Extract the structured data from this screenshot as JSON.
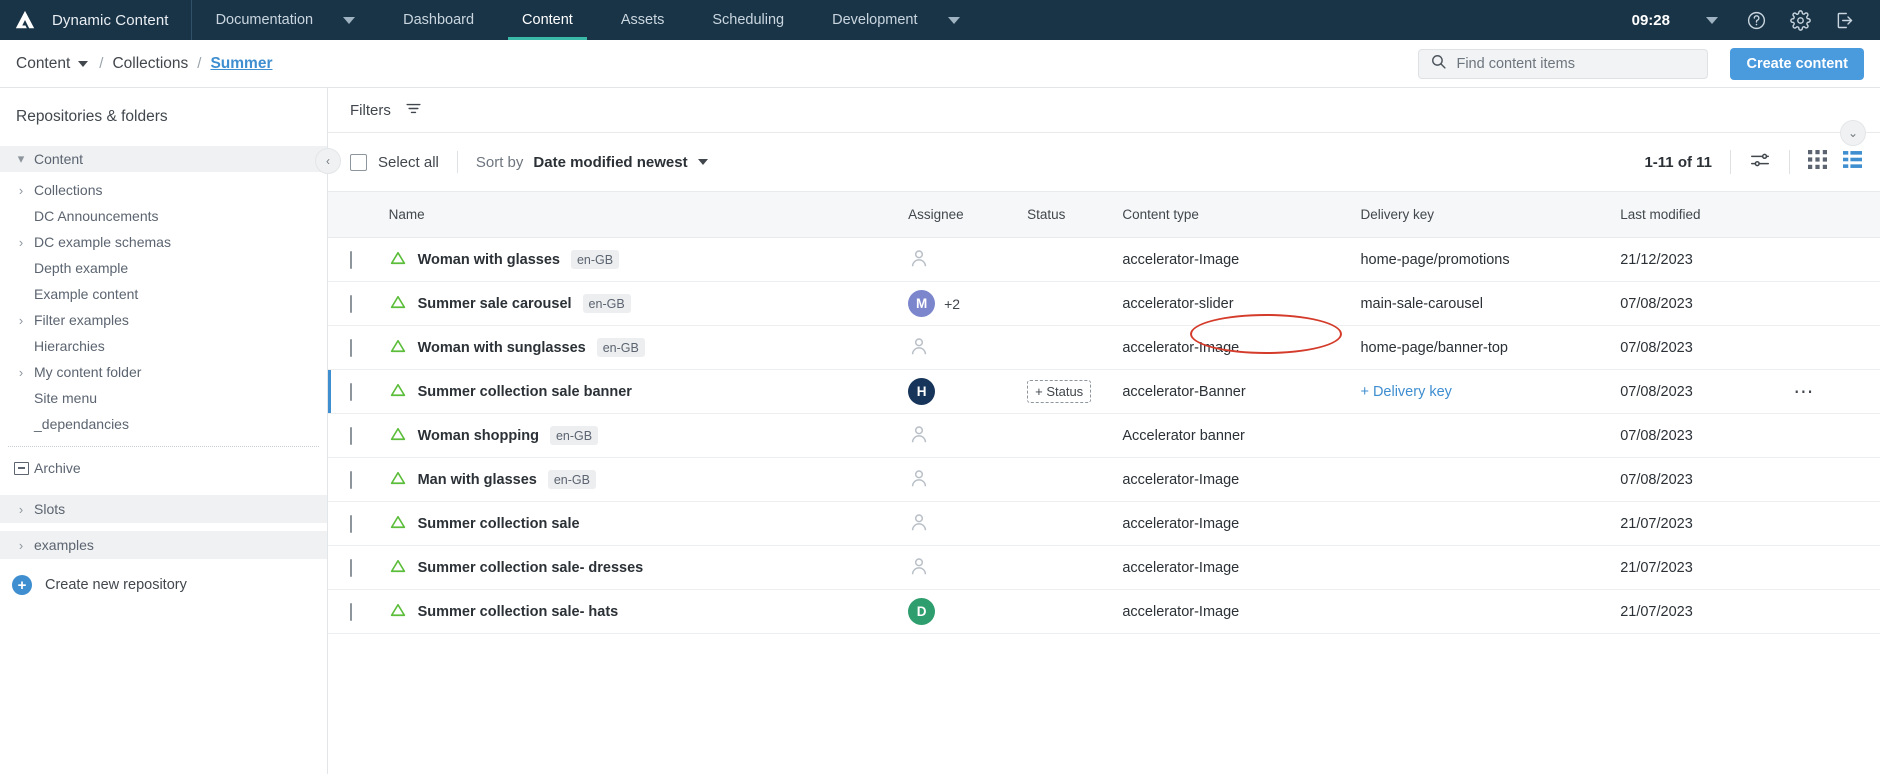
{
  "topnav": {
    "logo_icon": "amplience-logo-icon",
    "brand": "Dynamic Content",
    "items": [
      {
        "label": "Documentation",
        "active": false,
        "caret": true
      },
      {
        "label": "Dashboard",
        "active": false,
        "caret": false
      },
      {
        "label": "Content",
        "active": true,
        "caret": false
      },
      {
        "label": "Assets",
        "active": false,
        "caret": false
      },
      {
        "label": "Scheduling",
        "active": false,
        "caret": false
      },
      {
        "label": "Development",
        "active": false,
        "caret": true
      }
    ],
    "clock": "09:28",
    "user_caret_icon": "chevron-down-icon",
    "help_icon": "help-circle-icon",
    "settings_icon": "gear-icon",
    "logout_icon": "logout-icon"
  },
  "breadcrumb": {
    "items": [
      {
        "label": "Content",
        "caret": true,
        "link": false
      },
      {
        "label": "Collections",
        "caret": false,
        "link": false
      },
      {
        "label": "Summer",
        "caret": false,
        "link": true
      }
    ],
    "separator": "/"
  },
  "search": {
    "icon": "search-icon",
    "placeholder": "Find content items",
    "value": ""
  },
  "actions": {
    "create_content": "Create content"
  },
  "sidebar": {
    "title": "Repositories & folders",
    "tree": [
      {
        "label": "Content",
        "indent": 0,
        "chevron": "down",
        "shaded": true,
        "icon": null
      },
      {
        "label": "Collections",
        "indent": 1,
        "chevron": "right",
        "shaded": false,
        "icon": null
      },
      {
        "label": "DC Announcements",
        "indent": 1,
        "chevron": "none",
        "shaded": false,
        "icon": null
      },
      {
        "label": "DC example schemas",
        "indent": 1,
        "chevron": "right",
        "shaded": false,
        "icon": null
      },
      {
        "label": "Depth example",
        "indent": 1,
        "chevron": "none",
        "shaded": false,
        "icon": null
      },
      {
        "label": "Example content",
        "indent": 1,
        "chevron": "none",
        "shaded": false,
        "icon": null
      },
      {
        "label": "Filter examples",
        "indent": 1,
        "chevron": "right",
        "shaded": false,
        "icon": null
      },
      {
        "label": "Hierarchies",
        "indent": 1,
        "chevron": "none",
        "shaded": false,
        "icon": null
      },
      {
        "label": "My content folder",
        "indent": 1,
        "chevron": "right",
        "shaded": false,
        "icon": null
      },
      {
        "label": "Site menu",
        "indent": 1,
        "chevron": "none",
        "shaded": false,
        "icon": null
      },
      {
        "label": "_dependancies",
        "indent": 1,
        "chevron": "none",
        "shaded": false,
        "icon": null
      }
    ],
    "archive": {
      "label": "Archive",
      "icon": "archive-box-icon"
    },
    "groups": [
      {
        "label": "Slots",
        "chevron": "right",
        "shaded": true
      },
      {
        "label": "examples",
        "chevron": "right",
        "shaded": true
      }
    ],
    "create_repository": {
      "label": "Create new repository",
      "icon": "plus-circle-icon"
    }
  },
  "filters": {
    "label": "Filters",
    "icon": "filter-icon"
  },
  "toolbar": {
    "select_all": "Select all",
    "sort_by_label": "Sort by",
    "sort_by_value": "Date modified newest",
    "sort_caret_icon": "chevron-down-icon",
    "result_count": "1-11 of 11",
    "settings_icon": "sliders-icon",
    "grid_view_icon": "grid-view-icon",
    "list_view_icon": "list-view-icon",
    "collapse_icon": "chevron-left-icon",
    "scroll_icon": "chevron-down-icon"
  },
  "table": {
    "columns": [
      "Name",
      "Assignee",
      "Status",
      "Content type",
      "Delivery key",
      "Last modified"
    ],
    "rows": [
      {
        "name": "Woman with glasses",
        "locale": "en-GB",
        "assignee": null,
        "status": null,
        "content_type": "accelerator-Image",
        "delivery_key": "home-page/promotions",
        "last_modified": "21/12/2023",
        "selected": false,
        "menu": false
      },
      {
        "name": "Summer sale carousel",
        "locale": "en-GB",
        "assignee": {
          "initial": "M",
          "color": "#7b86cc",
          "extra": "+2"
        },
        "status": null,
        "content_type": "accelerator-slider",
        "delivery_key": "main-sale-carousel",
        "last_modified": "07/08/2023",
        "selected": false,
        "menu": false
      },
      {
        "name": "Woman with sunglasses",
        "locale": "en-GB",
        "assignee": null,
        "status": null,
        "content_type": "accelerator-Image",
        "delivery_key": "home-page/banner-top",
        "last_modified": "07/08/2023",
        "selected": false,
        "menu": false
      },
      {
        "name": "Summer collection sale banner",
        "locale": null,
        "assignee": {
          "initial": "H",
          "color": "#17355a",
          "extra": null
        },
        "status": "+ Status",
        "content_type": "accelerator-Banner",
        "delivery_key": "+ Delivery key",
        "delivery_key_is_add": true,
        "last_modified": "07/08/2023",
        "selected": true,
        "menu": true
      },
      {
        "name": "Woman shopping",
        "locale": "en-GB",
        "assignee": null,
        "status": null,
        "content_type": "Accelerator banner",
        "delivery_key": "",
        "last_modified": "07/08/2023",
        "selected": false,
        "menu": false
      },
      {
        "name": "Man with glasses",
        "locale": "en-GB",
        "assignee": null,
        "status": null,
        "content_type": "accelerator-Image",
        "delivery_key": "",
        "last_modified": "07/08/2023",
        "selected": false,
        "menu": false
      },
      {
        "name": "Summer collection sale",
        "locale": null,
        "assignee": null,
        "status": null,
        "content_type": "accelerator-Image",
        "delivery_key": "",
        "last_modified": "21/07/2023",
        "selected": false,
        "menu": false
      },
      {
        "name": "Summer collection sale- dresses",
        "locale": null,
        "assignee": null,
        "status": null,
        "content_type": "accelerator-Image",
        "delivery_key": "",
        "last_modified": "21/07/2023",
        "selected": false,
        "menu": false
      },
      {
        "name": "Summer collection sale- hats",
        "locale": null,
        "assignee": {
          "initial": "D",
          "color": "#2f9e6e",
          "extra": null
        },
        "status": null,
        "content_type": "accelerator-Image",
        "delivery_key": "",
        "last_modified": "21/07/2023",
        "selected": false,
        "menu": false
      }
    ]
  },
  "annotation": {
    "shape": "ellipse",
    "color": "#d43b2a",
    "target": "+ Delivery key"
  },
  "colors": {
    "topnav_bg": "#1a3447",
    "accent_teal": "#3bb9a8",
    "primary_blue": "#4a9ade",
    "link_blue": "#3e8ed0",
    "content_icon_green": "#5bbd3a",
    "annotation_red": "#d43b2a"
  }
}
